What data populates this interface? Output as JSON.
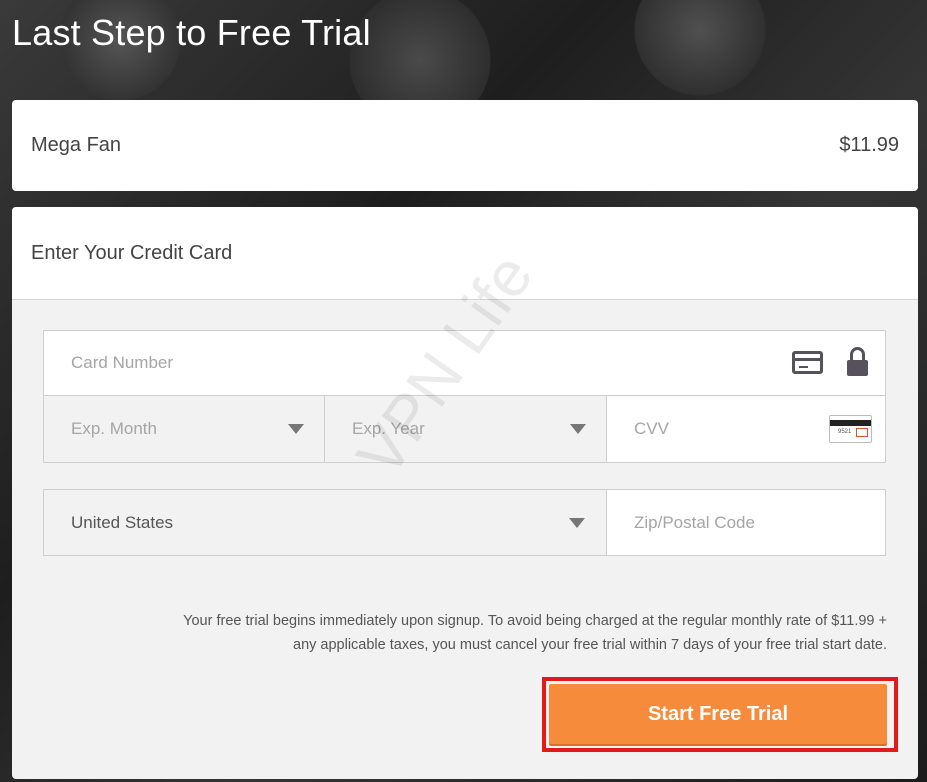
{
  "page": {
    "title": "Last Step to Free Trial"
  },
  "plan": {
    "name": "Mega Fan",
    "price": "$11.99"
  },
  "credit_card": {
    "heading": "Enter Your Credit Card",
    "card_number_placeholder": "Card Number",
    "exp_month_placeholder": "Exp. Month",
    "exp_year_placeholder": "Exp. Year",
    "cvv_placeholder": "CVV",
    "cvv_card_digits": "9521",
    "country_value": "United States",
    "zip_placeholder": "Zip/Postal Code",
    "icons": [
      "credit-card-icon",
      "lock-icon",
      "cvv-card-icon",
      "chevron-down-icon"
    ]
  },
  "disclaimer": {
    "line1": "Your free trial begins immediately upon signup. To avoid being charged at the regular monthly rate of $11.99 +",
    "line2": "any applicable taxes, you must cancel your free trial within 7 days of your free trial start date."
  },
  "cta": {
    "label": "Start Free Trial",
    "button_color": "#f68b3c",
    "highlight_color": "#e21a1a"
  },
  "watermark": {
    "text": "VPN Life"
  }
}
